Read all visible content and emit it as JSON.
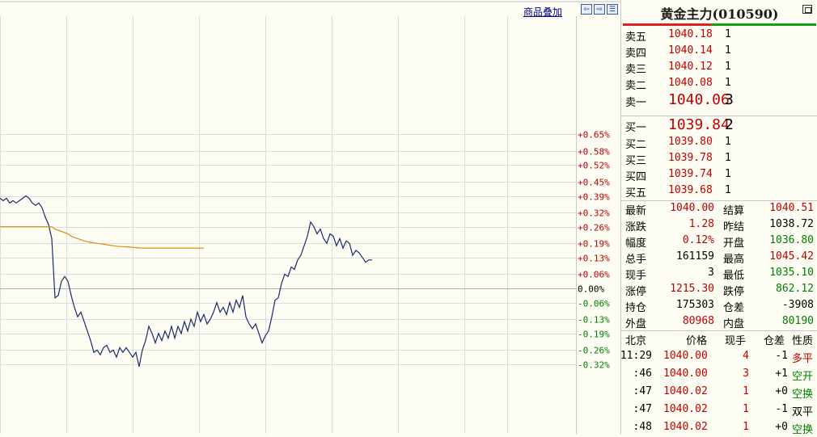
{
  "toolbar": {
    "overlay_label": "商品叠加",
    "nav_left": "⇦",
    "nav_right": "⇨",
    "nav_menu": "☰"
  },
  "axis": {
    "ticks": [
      "+0.65%",
      "+0.58%",
      "+0.52%",
      "+0.45%",
      "+0.39%",
      "+0.32%",
      "+0.26%",
      "+0.19%",
      "+0.13%",
      "+0.06%",
      "0.00%",
      "-0.06%",
      "-0.13%",
      "-0.19%",
      "-0.26%",
      "-0.32%"
    ]
  },
  "colors": {
    "price_line": "#1a2a6e",
    "avg_line": "#e08a10",
    "up": "#c00000",
    "down": "#008000",
    "grid": "#dcdcdc"
  },
  "chart_data": {
    "type": "line",
    "title": "",
    "y_unit": "%",
    "ylim": [
      -0.33,
      0.66
    ],
    "series": [
      {
        "values": [
          0.38,
          0.37,
          0.38,
          0.36,
          0.37,
          0.36,
          0.37,
          0.38,
          0.39,
          0.38,
          0.36,
          0.35,
          0.36,
          0.34,
          0.3,
          0.27,
          0.21,
          -0.04,
          -0.03,
          0.03,
          0.05,
          0.03,
          -0.03,
          -0.08,
          -0.12,
          -0.1,
          -0.14,
          -0.18,
          -0.22,
          -0.27,
          -0.26,
          -0.28,
          -0.25,
          -0.24,
          -0.27,
          -0.26,
          -0.29,
          -0.25,
          -0.27,
          -0.25,
          -0.27,
          -0.29,
          -0.27,
          -0.33,
          -0.26,
          -0.22,
          -0.16,
          -0.19,
          -0.23,
          -0.19,
          -0.22,
          -0.18,
          -0.21,
          -0.16,
          -0.21,
          -0.16,
          -0.19,
          -0.14,
          -0.18,
          -0.13,
          -0.16,
          -0.1,
          -0.14,
          -0.11,
          -0.15,
          -0.13,
          -0.1,
          -0.06,
          -0.1,
          -0.08,
          -0.11,
          -0.06,
          -0.1,
          -0.05,
          -0.08,
          -0.03,
          -0.12,
          -0.15,
          -0.17,
          -0.15,
          -0.19,
          -0.23,
          -0.2,
          -0.18,
          -0.12,
          -0.05,
          -0.04,
          0.02,
          0.06,
          0.05,
          0.09,
          0.08,
          0.12,
          0.14,
          0.18,
          0.22,
          0.28,
          0.26,
          0.23,
          0.25,
          0.21,
          0.19,
          0.23,
          0.22,
          0.18,
          0.21,
          0.17,
          0.2,
          0.19,
          0.14,
          0.16,
          0.15,
          0.13,
          0.11,
          0.12,
          0.12
        ]
      },
      {
        "values": [
          0.26,
          0.26,
          0.26,
          0.26,
          0.26,
          0.26,
          0.26,
          0.26,
          0.26,
          0.26,
          0.26,
          0.26,
          0.26,
          0.26,
          0.26,
          0.26,
          0.26,
          0.25,
          0.245,
          0.24,
          0.235,
          0.23,
          0.22,
          0.215,
          0.21,
          0.205,
          0.2,
          0.197,
          0.194,
          0.192,
          0.19,
          0.188,
          0.186,
          0.184,
          0.182,
          0.18,
          0.178,
          0.177,
          0.176,
          0.175,
          0.174,
          0.173,
          0.172,
          0.171,
          0.17,
          0.17,
          0.17,
          0.17,
          0.17,
          0.17,
          0.17,
          0.17,
          0.17,
          0.17,
          0.17,
          0.17,
          0.17,
          0.17,
          0.17,
          0.17,
          0.17,
          0.17,
          0.17,
          0.17
        ]
      }
    ]
  },
  "panel": {
    "title": "黄金主力(010590)",
    "asks": [
      {
        "label": "卖五",
        "price": "1040.18",
        "vol": "1"
      },
      {
        "label": "卖四",
        "price": "1040.14",
        "vol": "1"
      },
      {
        "label": "卖三",
        "price": "1040.12",
        "vol": "1"
      },
      {
        "label": "卖二",
        "price": "1040.08",
        "vol": "1"
      },
      {
        "label": "卖一",
        "price": "1040.06",
        "vol": "3"
      }
    ],
    "bids": [
      {
        "label": "买一",
        "price": "1039.84",
        "vol": "2"
      },
      {
        "label": "买二",
        "price": "1039.80",
        "vol": "1"
      },
      {
        "label": "买三",
        "price": "1039.78",
        "vol": "1"
      },
      {
        "label": "买四",
        "price": "1039.74",
        "vol": "1"
      },
      {
        "label": "买五",
        "price": "1039.68",
        "vol": "1"
      }
    ],
    "stats": [
      {
        "l1": "最新",
        "v1": "1040.00",
        "c1": "red",
        "l2": "结算",
        "v2": "1040.51",
        "c2": "red"
      },
      {
        "l1": "涨跌",
        "v1": "1.28",
        "c1": "red",
        "l2": "昨结",
        "v2": "1038.72",
        "c2": "blk"
      },
      {
        "l1": "幅度",
        "v1": "0.12%",
        "c1": "red",
        "l2": "开盘",
        "v2": "1036.80",
        "c2": "green"
      },
      {
        "l1": "总手",
        "v1": "161159",
        "c1": "blk",
        "l2": "最高",
        "v2": "1045.42",
        "c2": "red"
      },
      {
        "l1": "现手",
        "v1": "3",
        "c1": "blk",
        "l2": "最低",
        "v2": "1035.10",
        "c2": "green"
      },
      {
        "l1": "涨停",
        "v1": "1215.30",
        "c1": "red",
        "l2": "跌停",
        "v2": "862.12",
        "c2": "green"
      },
      {
        "l1": "持仓",
        "v1": "175303",
        "c1": "blk",
        "l2": "仓差",
        "v2": "-3908",
        "c2": "blk"
      },
      {
        "l1": "外盘",
        "v1": "80968",
        "c1": "red",
        "l2": "内盘",
        "v2": "80190",
        "c2": "green"
      }
    ],
    "ticks_header": {
      "time": "北京",
      "price": "价格",
      "vol": "现手",
      "diff": "仓差",
      "nature": "性质"
    },
    "ticks": [
      {
        "time": "11:29",
        "price": "1040.00",
        "vol": "4",
        "diff": "-1",
        "nature": "多平",
        "nc": "red"
      },
      {
        "time": ":46",
        "price": "1040.00",
        "vol": "3",
        "diff": "+1",
        "nature": "空开",
        "nc": "green"
      },
      {
        "time": ":47",
        "price": "1040.02",
        "vol": "1",
        "diff": "+0",
        "nature": "空换",
        "nc": "green"
      },
      {
        "time": ":47",
        "price": "1040.02",
        "vol": "1",
        "diff": "-1",
        "nature": "双平",
        "nc": "blk"
      },
      {
        "time": ":48",
        "price": "1040.02",
        "vol": "1",
        "diff": "+0",
        "nature": "空换",
        "nc": "green"
      }
    ]
  }
}
